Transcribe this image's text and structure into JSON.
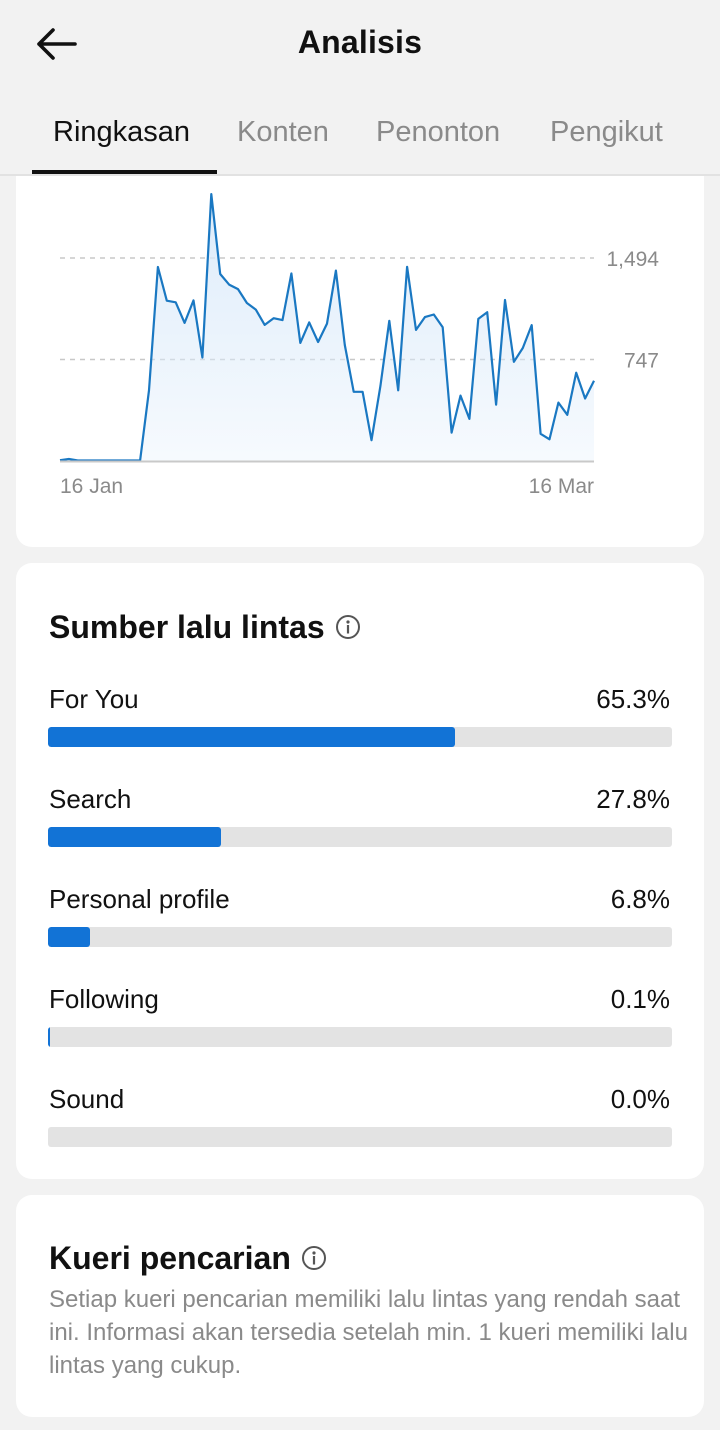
{
  "header": {
    "title": "Analisis",
    "back_icon": "arrow-left-icon"
  },
  "tabs": [
    {
      "label": "Ringkasan",
      "active": true
    },
    {
      "label": "Konten",
      "active": false
    },
    {
      "label": "Penonton",
      "active": false
    },
    {
      "label": "Pengikut",
      "active": false
    }
  ],
  "chart_data": {
    "type": "area",
    "x_tick_labels": [
      "16 Jan",
      "16 Mar"
    ],
    "y_tick_labels": [
      "1,494",
      "747"
    ],
    "y_ticks": [
      1494,
      747
    ],
    "ylim": [
      0,
      1900
    ],
    "grid": "dashed horizontal at y ticks",
    "color": "#1a78c2",
    "fill_color": "#dcebfa",
    "values": [
      6,
      15,
      4,
      4,
      4,
      4,
      4,
      4,
      4,
      4,
      520,
      1428,
      1180,
      1168,
      1016,
      1182,
      762,
      1964,
      1376,
      1298,
      1265,
      1163,
      1114,
      1002,
      1051,
      1037,
      1380,
      869,
      1020,
      876,
      1011,
      1401,
      854,
      509,
      509,
      153,
      551,
      1032,
      520,
      1429,
      965,
      1059,
      1078,
      984,
      209,
      481,
      310,
      1046,
      1095,
      414,
      1185,
      730,
      832,
      1000,
      200,
      160,
      430,
      340,
      650,
      460,
      590
    ]
  },
  "traffic": {
    "title": "Sumber lalu lintas",
    "info_icon": "info-circle-icon",
    "rows": [
      {
        "label": "For You",
        "value": "65.3%",
        "fraction": 0.653
      },
      {
        "label": "Search",
        "value": "27.8%",
        "fraction": 0.278
      },
      {
        "label": "Personal profile",
        "value": "6.8%",
        "fraction": 0.068
      },
      {
        "label": "Following",
        "value": "0.1%",
        "fraction": 0.001
      },
      {
        "label": "Sound",
        "value": "0.0%",
        "fraction": 0.0
      }
    ]
  },
  "search_queries": {
    "title": "Kueri pencarian",
    "info_icon": "info-circle-icon",
    "description": "Setiap kueri pencarian memiliki lalu lintas yang rendah saat ini. Informasi akan tersedia setelah min. 1 kueri memiliki lalu lintas yang cukup."
  }
}
